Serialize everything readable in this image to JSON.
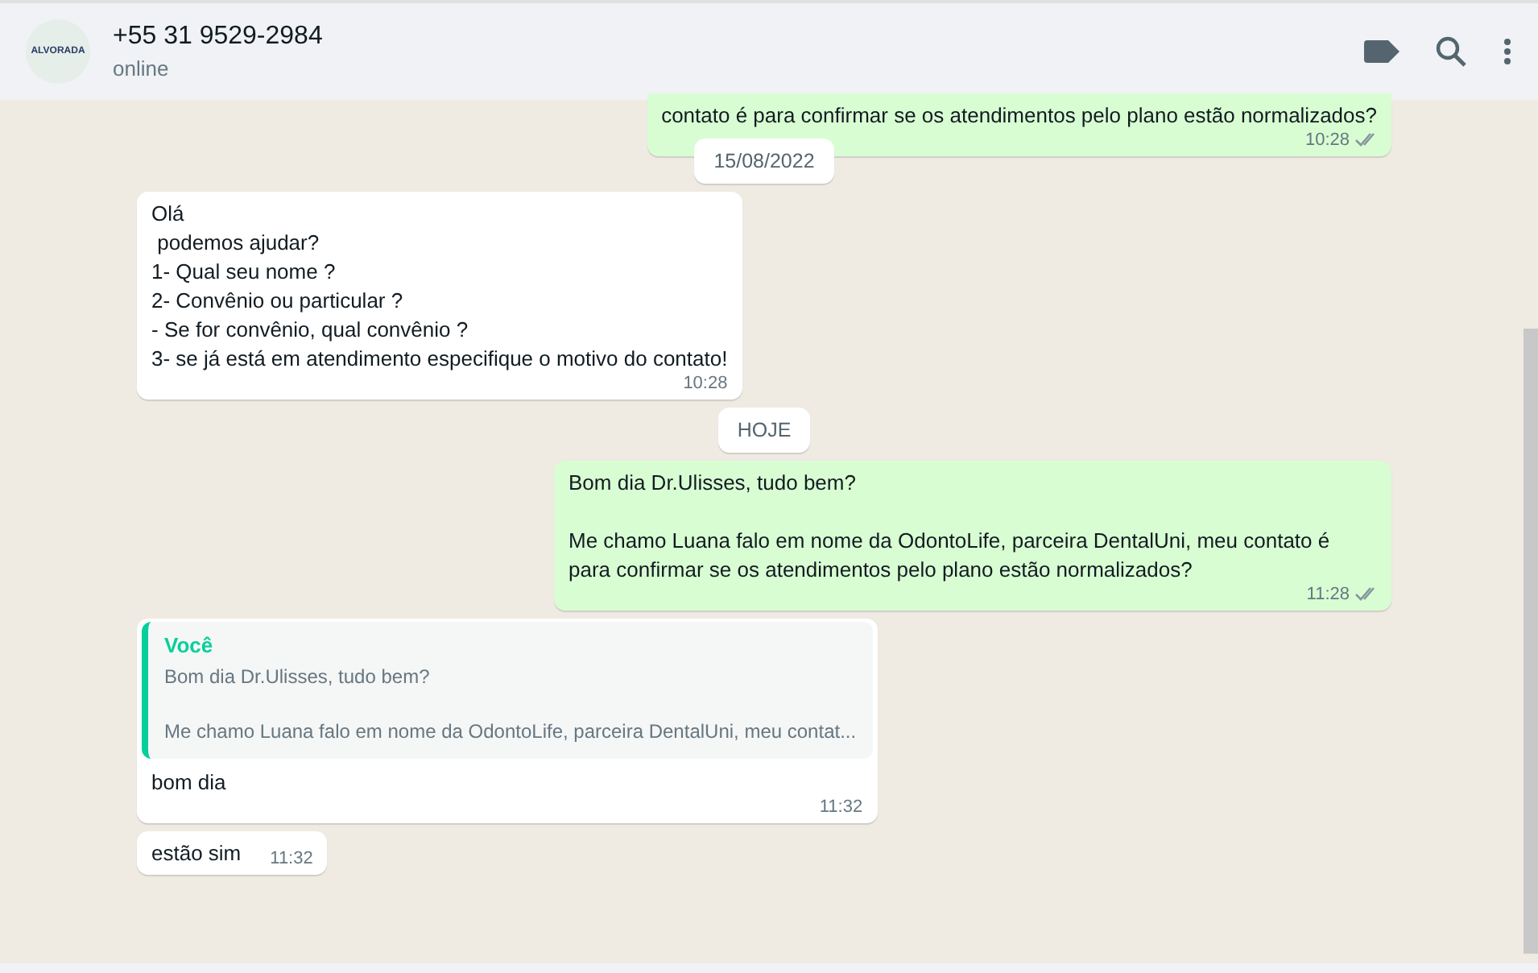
{
  "header": {
    "avatar_text": "ALVORADA",
    "name": "+55 31 9529-2984",
    "status": "online"
  },
  "messages": [
    {
      "kind": "outgoing",
      "text": "contato é para confirmar se os atendimentos pelo plano estão normalizados?",
      "time": "10:28",
      "ticks": true
    },
    {
      "kind": "date",
      "text": "15/08/2022"
    },
    {
      "kind": "incoming",
      "text": "Olá\n podemos ajudar?\n1- Qual seu nome ?\n2- Convênio ou particular ?\n- Se for convênio, qual convênio ?\n3- se já está em atendimento especifique o motivo do contato!",
      "time": "10:28"
    },
    {
      "kind": "date",
      "text": "HOJE"
    },
    {
      "kind": "outgoing",
      "text": "Bom dia Dr.Ulisses, tudo bem?\n\nMe chamo Luana falo em nome da OdontoLife, parceira DentalUni, meu contato é para confirmar se os atendimentos pelo plano estão normalizados?",
      "time": "11:28",
      "ticks": true
    },
    {
      "kind": "incoming",
      "quote": {
        "author": "Você",
        "text": "Bom dia Dr.Ulisses, tudo bem?\n\nMe chamo Luana falo em nome da OdontoLife, parceira DentalUni, meu contat..."
      },
      "text": "bom dia",
      "time": "11:32"
    },
    {
      "kind": "incoming",
      "text": "estão sim",
      "time": "11:32"
    }
  ]
}
